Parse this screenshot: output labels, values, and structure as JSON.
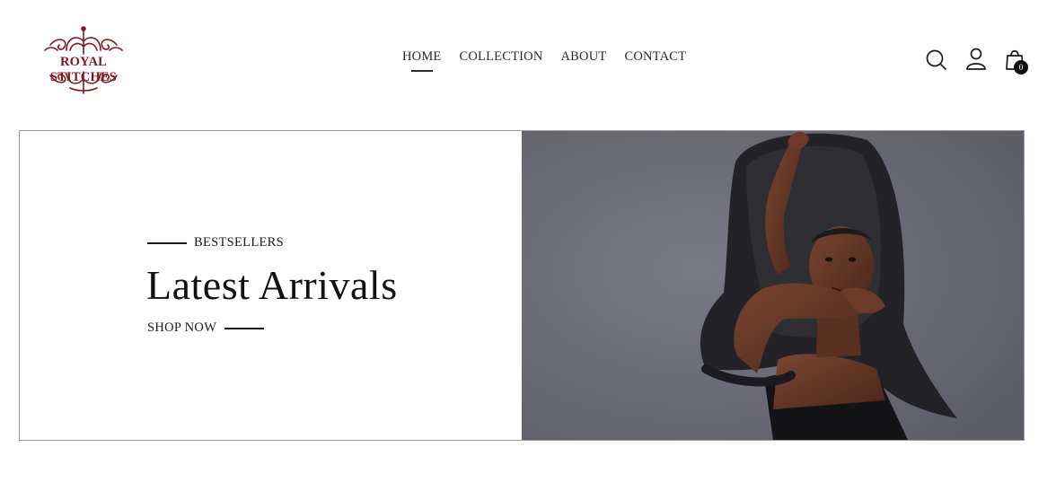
{
  "brand": {
    "name": "ROYAL STITCHES",
    "color": "#7d1a22"
  },
  "nav": {
    "items": [
      {
        "label": "HOME",
        "active": true
      },
      {
        "label": "COLLECTION",
        "active": false
      },
      {
        "label": "ABOUT",
        "active": false
      },
      {
        "label": "CONTACT",
        "active": false
      }
    ]
  },
  "header_icons": {
    "search": "search-icon",
    "account": "user-icon",
    "cart": "shopping-bag-icon",
    "cart_count": "0"
  },
  "hero": {
    "eyebrow": "BESTSELLERS",
    "title": "Latest Arrivals",
    "cta": "SHOP NOW",
    "image": "model-in-wide-black-hat-photo",
    "image_bg": "#6e6e78"
  }
}
